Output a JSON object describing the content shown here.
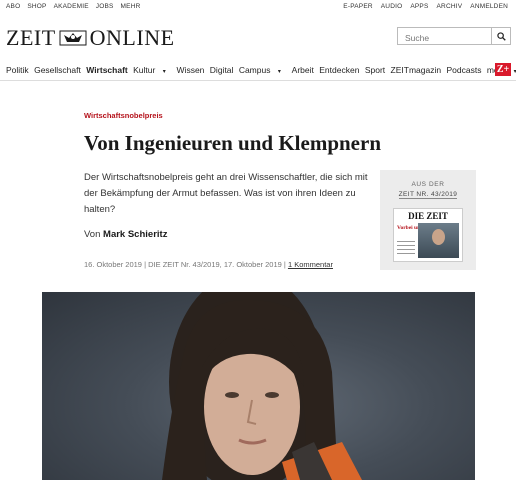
{
  "top_links_left": [
    "ABO",
    "SHOP",
    "AKADEMIE",
    "JOBS",
    "MEHR"
  ],
  "top_links_right": [
    "E-PAPER",
    "AUDIO",
    "APPS",
    "ARCHIV",
    "ANMELDEN"
  ],
  "logo": {
    "left": "ZEIT",
    "right": "ONLINE"
  },
  "search": {
    "placeholder": "Suche",
    "icon": "search-icon"
  },
  "nav": {
    "items": [
      "Politik",
      "Gesellschaft",
      "Wirtschaft",
      "Kultur",
      "Wissen",
      "Digital",
      "Campus",
      "Arbeit",
      "Entdecken",
      "Sport",
      "ZEITmagazin",
      "Podcasts",
      "mehr"
    ],
    "active": "Wirtschaft",
    "dropdowns": [
      "Kultur",
      "Campus",
      "mehr"
    ],
    "zplus": "Z+"
  },
  "article": {
    "kicker": "Wirtschaftsnobelpreis",
    "title": "Von Ingenieuren und Klempnern",
    "summary": "Der Wirtschaftsnobelpreis geht an drei Wissenschaftler, die sich mit der Bekämpfung der Armut befassen. Was ist von ihren Ideen zu halten?",
    "byline_prefix": "Von",
    "author": "Mark Schieritz",
    "date": "16. Oktober 2019",
    "source": "DIE ZEIT Nr. 43/2019, 17. Oktober 2019",
    "comments": "1 Kommentar"
  },
  "issue_box": {
    "label": "AUS DER",
    "issue": "ZEIT NR. 43/2019",
    "cover_masthead": "DIE ZEIT",
    "cover_headline": "Vorbei und verdammt"
  },
  "colors": {
    "accent": "#b5121b",
    "zplus": "#d9192b",
    "issue_bg": "#ececec"
  }
}
